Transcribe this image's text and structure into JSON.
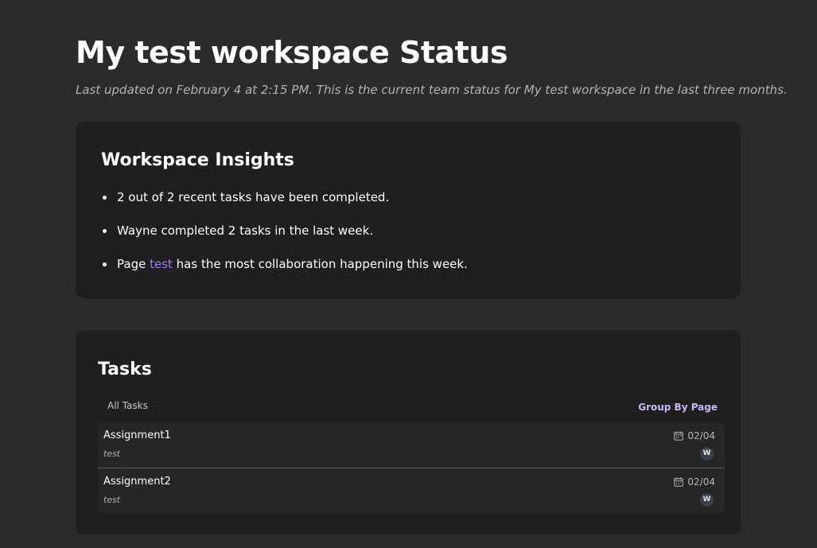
{
  "header": {
    "title": "My test workspace Status",
    "subtitle": "Last updated on February 4 at 2:15 PM. This is the current team status for My test workspace in the last three months."
  },
  "insights": {
    "heading": "Workspace Insights",
    "items": [
      {
        "text": "2 out of 2 recent tasks have been completed."
      },
      {
        "text": "Wayne completed 2 tasks in the last week."
      },
      {
        "prefix": "Page ",
        "link": "test",
        "suffix": " has the most collaboration happening this week."
      }
    ]
  },
  "tasks": {
    "heading": "Tasks",
    "filter_label": "All Tasks",
    "group_by_label": "Group By Page",
    "rows": [
      {
        "name": "Assignment1",
        "page": "test",
        "date": "02/04",
        "assignee_initial": "W"
      },
      {
        "name": "Assignment2",
        "page": "test",
        "date": "02/04",
        "assignee_initial": "W"
      }
    ]
  },
  "colors": {
    "background": "#2b2b2b",
    "card": "#1f1f1f",
    "link": "#a57cf5",
    "accent": "#c9b8f7"
  }
}
